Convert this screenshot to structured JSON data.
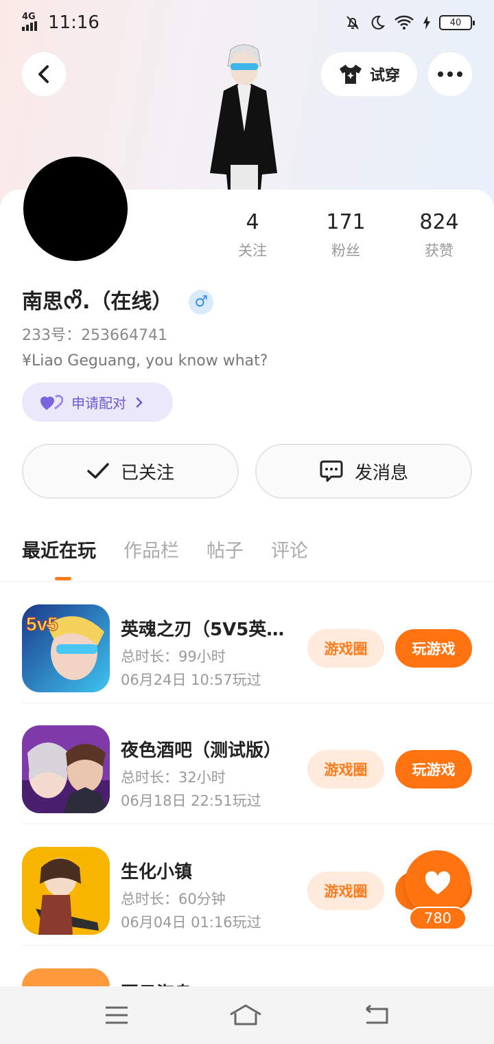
{
  "status_bar": {
    "network": "4G",
    "time": "11:16",
    "battery": "40"
  },
  "header": {
    "try_on_label": "试穿"
  },
  "profile": {
    "name": "南思ᰔᩚ.（在线）",
    "gender_symbol": "♂",
    "id_line": "233号：253664741",
    "bio": "¥Liao Geguang, you know what?",
    "pair_label": "申请配对",
    "stats": [
      {
        "num": "4",
        "label": "关注"
      },
      {
        "num": "171",
        "label": "粉丝"
      },
      {
        "num": "824",
        "label": "获赞"
      }
    ]
  },
  "actions": {
    "follow_label": "已关注",
    "message_label": "发消息"
  },
  "tabs": [
    "最近在玩",
    "作品栏",
    "帖子",
    "评论"
  ],
  "games": [
    {
      "title": "英魂之刃（5V5英…",
      "duration": "总时长：99小时",
      "last_played": "06月24日 10:57玩过",
      "circle_label": "游戏圈",
      "play_label": "玩游戏",
      "icon_text": "5v5"
    },
    {
      "title": "夜色酒吧（测试版）",
      "duration": "总时长：32小时",
      "last_played": "06月18日 22:51玩过",
      "circle_label": "游戏圈",
      "play_label": "玩游戏"
    },
    {
      "title": "生化小镇",
      "duration": "总时长：60分钟",
      "last_played": "06月04日 01:16玩过",
      "circle_label": "游戏圈",
      "play_label": "玩游戏"
    },
    {
      "title": "夏日海岛"
    }
  ],
  "like": {
    "count": "780"
  }
}
